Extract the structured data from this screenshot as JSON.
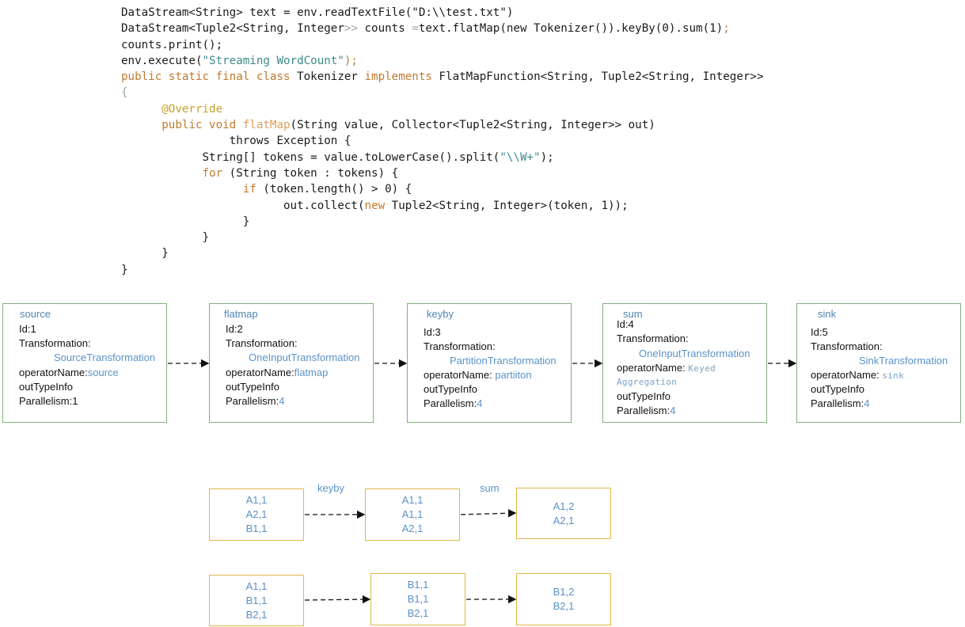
{
  "code": {
    "lines": [
      [
        [
          "t",
          "DataStream<String> text = env.readTextFile(\"D:\\\\test.txt\")"
        ]
      ],
      [
        [
          "t",
          "DataStream<Tuple2<String, Integer"
        ],
        [
          "d",
          ">> "
        ],
        [
          "t",
          "counts "
        ],
        [
          "d",
          "="
        ],
        [
          "t",
          "text.flatMap(new Tokenizer()).keyBy(0).sum(1)"
        ],
        [
          "k",
          ";"
        ]
      ],
      [
        [
          "t",
          "counts.print();"
        ]
      ],
      [
        [
          "t",
          "env.execute("
        ],
        [
          "s",
          "\"Streaming WordCount\""
        ],
        [
          "k",
          ");"
        ]
      ],
      [
        [
          "k",
          "public static final class "
        ],
        [
          "t",
          "Tokenizer "
        ],
        [
          "k",
          "implements "
        ],
        [
          "t",
          "FlatMapFunction<String, Tuple2<String, Integer>>"
        ]
      ],
      [
        [
          "d",
          "{"
        ]
      ],
      [
        [
          "t",
          "      "
        ],
        [
          "a",
          "@Override"
        ]
      ],
      [
        [
          "t",
          "      "
        ],
        [
          "k",
          "public void "
        ],
        [
          "f",
          "flatMap"
        ],
        [
          "t",
          "(String value, Collector<Tuple2<String, Integer>> out)"
        ]
      ],
      [
        [
          "t",
          "                throws Exception {"
        ]
      ],
      [
        [
          "t",
          "            String[] tokens = value.toLowerCase().split("
        ],
        [
          "s",
          "\"\\\\W+\""
        ],
        [
          "t",
          ");"
        ]
      ],
      [
        [
          "t",
          "            "
        ],
        [
          "k",
          "for "
        ],
        [
          "t",
          "(String token : tokens) {"
        ]
      ],
      [
        [
          "t",
          "                  "
        ],
        [
          "k",
          "if "
        ],
        [
          "t",
          "(token.length() > 0) {"
        ]
      ],
      [
        [
          "t",
          "                        out.collect("
        ],
        [
          "k",
          "new "
        ],
        [
          "t",
          "Tuple2<String, Integer>(token, 1));"
        ]
      ],
      [
        [
          "t",
          "                  }"
        ]
      ],
      [
        [
          "t",
          "            }"
        ]
      ],
      [
        [
          "t",
          "      }"
        ]
      ],
      [
        [
          "t",
          "}"
        ]
      ]
    ]
  },
  "transformations": [
    {
      "name": "source",
      "id": "Id:1",
      "transformation_label": "Transformation:",
      "transformation": "SourceTransformation",
      "operator_label": "operatorName:",
      "operator": "source",
      "outtype": "outTypeInfo",
      "parallelism_label": "Parallelism:",
      "parallelism": "1"
    },
    {
      "name": "flatmap",
      "id": "Id:2",
      "transformation_label": "Transformation:",
      "transformation": "OneInputTransformation",
      "operator_label": "operatorName:",
      "operator": "flatmap",
      "outtype": "outTypeInfo",
      "parallelism_label": "Parallelism:",
      "parallelism": "4"
    },
    {
      "name": "keyby",
      "id": "Id:3",
      "transformation_label": "Transformation:",
      "transformation": "PartitionTransformation",
      "operator_label": "operatorName: ",
      "operator": "partiiton",
      "outtype": "outTypeInfo",
      "parallelism_label": "Parallelism:",
      "parallelism": "4"
    },
    {
      "name": "sum",
      "id": "Id:4",
      "transformation_label": "Transformation:",
      "transformation": "OneInputTransformation",
      "operator_label": "operatorName: ",
      "operator": "Keyed",
      "operator_cont": "Aggregation",
      "outtype": "outTypeInfo",
      "parallelism_label": "Parallelism:",
      "parallelism": "4"
    },
    {
      "name": "sink",
      "id": "Id:5",
      "transformation_label": "Transformation:",
      "transformation": "SinkTransformation",
      "operator_label": "operatorName: ",
      "operator": "sink",
      "outtype": "outTypeInfo",
      "parallelism_label": "Parallelism:",
      "parallelism": "4"
    }
  ],
  "edge_labels": {
    "keyby": "keyby",
    "sum": "sum"
  },
  "partitions": [
    {
      "input": [
        "A1,1",
        "A2,1",
        "B1,1"
      ],
      "keyed": [
        "A1,1",
        "A1,1",
        "A2,1"
      ],
      "summed": [
        "A1,2",
        "A2,1"
      ]
    },
    {
      "input": [
        "A1,1",
        "B1,1",
        "B2,1"
      ],
      "keyed": [
        "B1,1",
        "B1,1",
        "B2,1"
      ],
      "summed": [
        "B1,2",
        "B2,1"
      ]
    }
  ],
  "colors": {
    "code_text": "#1a1a1a",
    "keyword": "#c07a30",
    "string": "#3d8a8a",
    "transformation_border": "#7fb17a",
    "tuple_border": "#e3b64a",
    "value_blue": "#5b93c8"
  }
}
